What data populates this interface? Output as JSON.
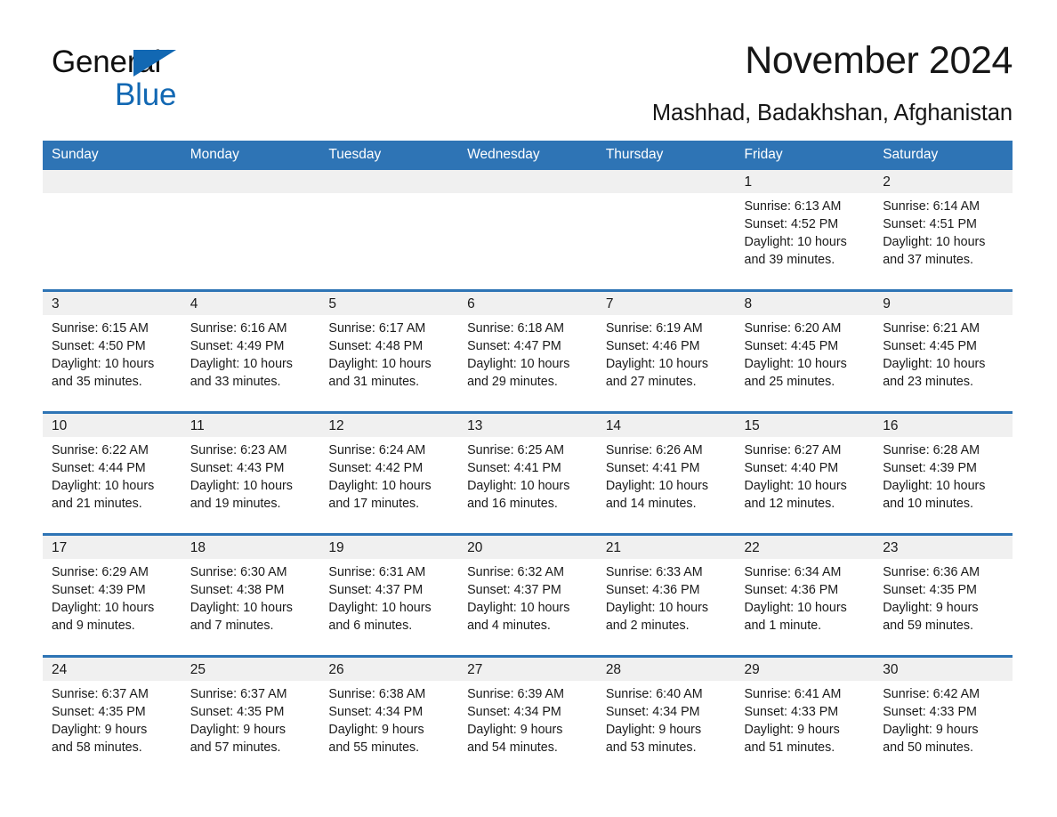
{
  "brand": {
    "line1": "General",
    "line2": "Blue",
    "accent_color": "#1268b3",
    "triangle_icon": "triangle-icon"
  },
  "header": {
    "month_title": "November 2024",
    "location": "Mashhad, Badakhshan, Afghanistan"
  },
  "theme": {
    "header_blue": "#2e74b5",
    "daynum_band": "#f0f0f0",
    "text": "#1a1a1a"
  },
  "calendar": {
    "weekday_headers": [
      "Sunday",
      "Monday",
      "Tuesday",
      "Wednesday",
      "Thursday",
      "Friday",
      "Saturday"
    ],
    "weeks": [
      [
        {
          "day": "",
          "empty": true
        },
        {
          "day": "",
          "empty": true
        },
        {
          "day": "",
          "empty": true
        },
        {
          "day": "",
          "empty": true
        },
        {
          "day": "",
          "empty": true
        },
        {
          "day": "1",
          "sunrise": "Sunrise: 6:13 AM",
          "sunset": "Sunset: 4:52 PM",
          "daylight_1": "Daylight: 10 hours",
          "daylight_2": "and 39 minutes."
        },
        {
          "day": "2",
          "sunrise": "Sunrise: 6:14 AM",
          "sunset": "Sunset: 4:51 PM",
          "daylight_1": "Daylight: 10 hours",
          "daylight_2": "and 37 minutes."
        }
      ],
      [
        {
          "day": "3",
          "sunrise": "Sunrise: 6:15 AM",
          "sunset": "Sunset: 4:50 PM",
          "daylight_1": "Daylight: 10 hours",
          "daylight_2": "and 35 minutes."
        },
        {
          "day": "4",
          "sunrise": "Sunrise: 6:16 AM",
          "sunset": "Sunset: 4:49 PM",
          "daylight_1": "Daylight: 10 hours",
          "daylight_2": "and 33 minutes."
        },
        {
          "day": "5",
          "sunrise": "Sunrise: 6:17 AM",
          "sunset": "Sunset: 4:48 PM",
          "daylight_1": "Daylight: 10 hours",
          "daylight_2": "and 31 minutes."
        },
        {
          "day": "6",
          "sunrise": "Sunrise: 6:18 AM",
          "sunset": "Sunset: 4:47 PM",
          "daylight_1": "Daylight: 10 hours",
          "daylight_2": "and 29 minutes."
        },
        {
          "day": "7",
          "sunrise": "Sunrise: 6:19 AM",
          "sunset": "Sunset: 4:46 PM",
          "daylight_1": "Daylight: 10 hours",
          "daylight_2": "and 27 minutes."
        },
        {
          "day": "8",
          "sunrise": "Sunrise: 6:20 AM",
          "sunset": "Sunset: 4:45 PM",
          "daylight_1": "Daylight: 10 hours",
          "daylight_2": "and 25 minutes."
        },
        {
          "day": "9",
          "sunrise": "Sunrise: 6:21 AM",
          "sunset": "Sunset: 4:45 PM",
          "daylight_1": "Daylight: 10 hours",
          "daylight_2": "and 23 minutes."
        }
      ],
      [
        {
          "day": "10",
          "sunrise": "Sunrise: 6:22 AM",
          "sunset": "Sunset: 4:44 PM",
          "daylight_1": "Daylight: 10 hours",
          "daylight_2": "and 21 minutes."
        },
        {
          "day": "11",
          "sunrise": "Sunrise: 6:23 AM",
          "sunset": "Sunset: 4:43 PM",
          "daylight_1": "Daylight: 10 hours",
          "daylight_2": "and 19 minutes."
        },
        {
          "day": "12",
          "sunrise": "Sunrise: 6:24 AM",
          "sunset": "Sunset: 4:42 PM",
          "daylight_1": "Daylight: 10 hours",
          "daylight_2": "and 17 minutes."
        },
        {
          "day": "13",
          "sunrise": "Sunrise: 6:25 AM",
          "sunset": "Sunset: 4:41 PM",
          "daylight_1": "Daylight: 10 hours",
          "daylight_2": "and 16 minutes."
        },
        {
          "day": "14",
          "sunrise": "Sunrise: 6:26 AM",
          "sunset": "Sunset: 4:41 PM",
          "daylight_1": "Daylight: 10 hours",
          "daylight_2": "and 14 minutes."
        },
        {
          "day": "15",
          "sunrise": "Sunrise: 6:27 AM",
          "sunset": "Sunset: 4:40 PM",
          "daylight_1": "Daylight: 10 hours",
          "daylight_2": "and 12 minutes."
        },
        {
          "day": "16",
          "sunrise": "Sunrise: 6:28 AM",
          "sunset": "Sunset: 4:39 PM",
          "daylight_1": "Daylight: 10 hours",
          "daylight_2": "and 10 minutes."
        }
      ],
      [
        {
          "day": "17",
          "sunrise": "Sunrise: 6:29 AM",
          "sunset": "Sunset: 4:39 PM",
          "daylight_1": "Daylight: 10 hours",
          "daylight_2": "and 9 minutes."
        },
        {
          "day": "18",
          "sunrise": "Sunrise: 6:30 AM",
          "sunset": "Sunset: 4:38 PM",
          "daylight_1": "Daylight: 10 hours",
          "daylight_2": "and 7 minutes."
        },
        {
          "day": "19",
          "sunrise": "Sunrise: 6:31 AM",
          "sunset": "Sunset: 4:37 PM",
          "daylight_1": "Daylight: 10 hours",
          "daylight_2": "and 6 minutes."
        },
        {
          "day": "20",
          "sunrise": "Sunrise: 6:32 AM",
          "sunset": "Sunset: 4:37 PM",
          "daylight_1": "Daylight: 10 hours",
          "daylight_2": "and 4 minutes."
        },
        {
          "day": "21",
          "sunrise": "Sunrise: 6:33 AM",
          "sunset": "Sunset: 4:36 PM",
          "daylight_1": "Daylight: 10 hours",
          "daylight_2": "and 2 minutes."
        },
        {
          "day": "22",
          "sunrise": "Sunrise: 6:34 AM",
          "sunset": "Sunset: 4:36 PM",
          "daylight_1": "Daylight: 10 hours",
          "daylight_2": "and 1 minute."
        },
        {
          "day": "23",
          "sunrise": "Sunrise: 6:36 AM",
          "sunset": "Sunset: 4:35 PM",
          "daylight_1": "Daylight: 9 hours",
          "daylight_2": "and 59 minutes."
        }
      ],
      [
        {
          "day": "24",
          "sunrise": "Sunrise: 6:37 AM",
          "sunset": "Sunset: 4:35 PM",
          "daylight_1": "Daylight: 9 hours",
          "daylight_2": "and 58 minutes."
        },
        {
          "day": "25",
          "sunrise": "Sunrise: 6:37 AM",
          "sunset": "Sunset: 4:35 PM",
          "daylight_1": "Daylight: 9 hours",
          "daylight_2": "and 57 minutes."
        },
        {
          "day": "26",
          "sunrise": "Sunrise: 6:38 AM",
          "sunset": "Sunset: 4:34 PM",
          "daylight_1": "Daylight: 9 hours",
          "daylight_2": "and 55 minutes."
        },
        {
          "day": "27",
          "sunrise": "Sunrise: 6:39 AM",
          "sunset": "Sunset: 4:34 PM",
          "daylight_1": "Daylight: 9 hours",
          "daylight_2": "and 54 minutes."
        },
        {
          "day": "28",
          "sunrise": "Sunrise: 6:40 AM",
          "sunset": "Sunset: 4:34 PM",
          "daylight_1": "Daylight: 9 hours",
          "daylight_2": "and 53 minutes."
        },
        {
          "day": "29",
          "sunrise": "Sunrise: 6:41 AM",
          "sunset": "Sunset: 4:33 PM",
          "daylight_1": "Daylight: 9 hours",
          "daylight_2": "and 51 minutes."
        },
        {
          "day": "30",
          "sunrise": "Sunrise: 6:42 AM",
          "sunset": "Sunset: 4:33 PM",
          "daylight_1": "Daylight: 9 hours",
          "daylight_2": "and 50 minutes."
        }
      ]
    ]
  }
}
